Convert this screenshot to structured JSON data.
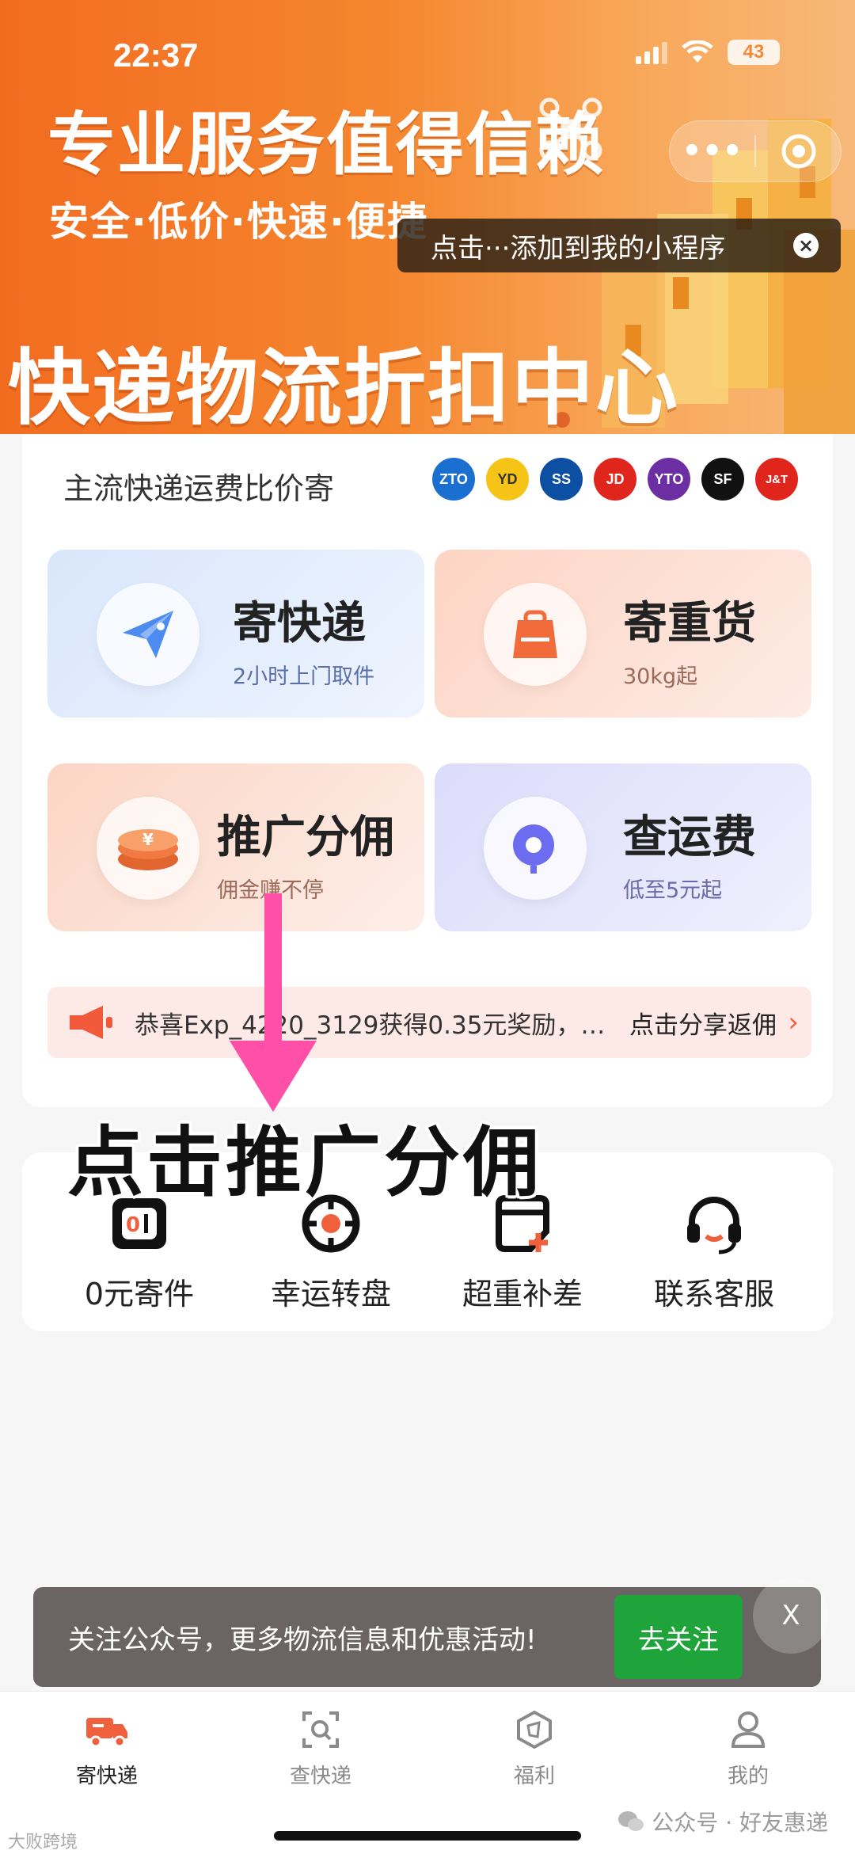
{
  "status_bar": {
    "time": "22:37",
    "battery": "43"
  },
  "banner": {
    "headline": "专业服务值得信赖",
    "subline": "安全·低价·快速·便捷",
    "title": "快递物流折扣中心",
    "capsule_more": "•••",
    "tooltip": "点击···添加到我的小程序",
    "tooltip_close": "×"
  },
  "compare": {
    "label": "主流快递运费比价寄",
    "carriers": [
      {
        "name": "ZTO",
        "color": "#1b6fd0"
      },
      {
        "name": "YD",
        "color": "#f5c417"
      },
      {
        "name": "SS",
        "color": "#0d4fa3"
      },
      {
        "name": "JD",
        "color": "#e0261c"
      },
      {
        "name": "YTO",
        "color": "#6b2fa3"
      },
      {
        "name": "SF",
        "color": "#111111"
      },
      {
        "name": "J&T",
        "color": "#e0261c"
      }
    ]
  },
  "tiles": {
    "send": {
      "title": "寄快递",
      "sub": "2小时上门取件"
    },
    "heavy": {
      "title": "寄重货",
      "sub": "30kg起"
    },
    "promo": {
      "title": "推广分佣",
      "sub": "佣金赚不停"
    },
    "fee": {
      "title": "查运费",
      "sub": "低至5元起"
    }
  },
  "ticker": {
    "message": "恭喜Exp_4220_3129获得0.35元奖励，…",
    "share": "点击分享返佣",
    "chevron": "›"
  },
  "annotation": "点击推广分佣",
  "quick_actions": [
    {
      "label": "0元寄件"
    },
    {
      "label": "幸运转盘"
    },
    {
      "label": "超重补差"
    },
    {
      "label": "联系客服"
    }
  ],
  "follow": {
    "text": "关注公众号，更多物流信息和优惠活动!",
    "button": "去关注",
    "close": "X"
  },
  "tabbar": [
    {
      "label": "寄快递",
      "active": true
    },
    {
      "label": "查快递",
      "active": false
    },
    {
      "label": "福利",
      "active": false
    },
    {
      "label": "我的",
      "active": false
    }
  ],
  "watermark": {
    "left": "大败跨境",
    "right": "公众号 · 好友惠递"
  },
  "colors": {
    "brand_orange": "#f26c20",
    "accent_red": "#f0603c",
    "follow_green": "#1fa33b"
  }
}
